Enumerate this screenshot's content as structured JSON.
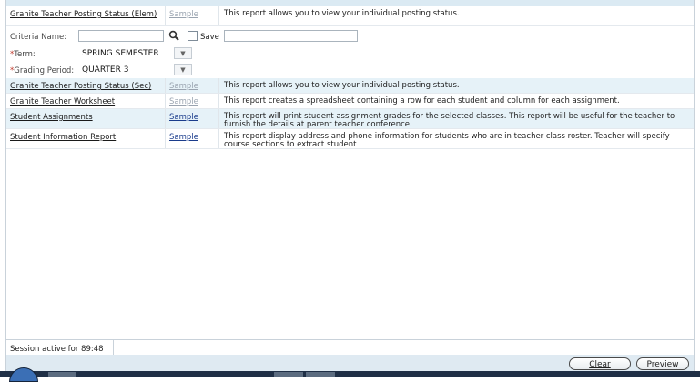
{
  "reports": [
    {
      "name": "Granite Teacher Posting Status (Elem)",
      "sample": "Sample",
      "description": "This report allows you to view your individual posting status."
    },
    {
      "name": "Granite Teacher Posting Status (Sec)",
      "sample": "Sample",
      "description": "This report allows you to view your individual posting status."
    },
    {
      "name": "Granite Teacher Worksheet",
      "sample": "Sample",
      "description": "This report creates a spreadsheet containing a row for each student and column for each assignment."
    },
    {
      "name": "Student Assignments",
      "sample": "Sample",
      "description": "This report will print student assignment grades for the selected classes. This report will be useful for the teacher to furnish the details at parent teacher conference."
    },
    {
      "name": "Student Information Report",
      "sample": "Sample",
      "description": "This report display address and phone information for students who are in teacher class roster. Teacher will specify course sections to extract student"
    }
  ],
  "criteria": {
    "criteria_name_label": "Criteria Name:",
    "criteria_name_value": "",
    "save_label": "Save",
    "saved_criteria_value": "",
    "required_marker": "*",
    "term_label": "Term:",
    "term_value": "SPRING SEMESTER",
    "grading_period_label": "Grading Period:",
    "grading_period_value": "QUARTER 3"
  },
  "status": {
    "session": "Session active for 89:48"
  },
  "buttons": {
    "clear_label": "Clear",
    "preview_label": "Preview"
  }
}
